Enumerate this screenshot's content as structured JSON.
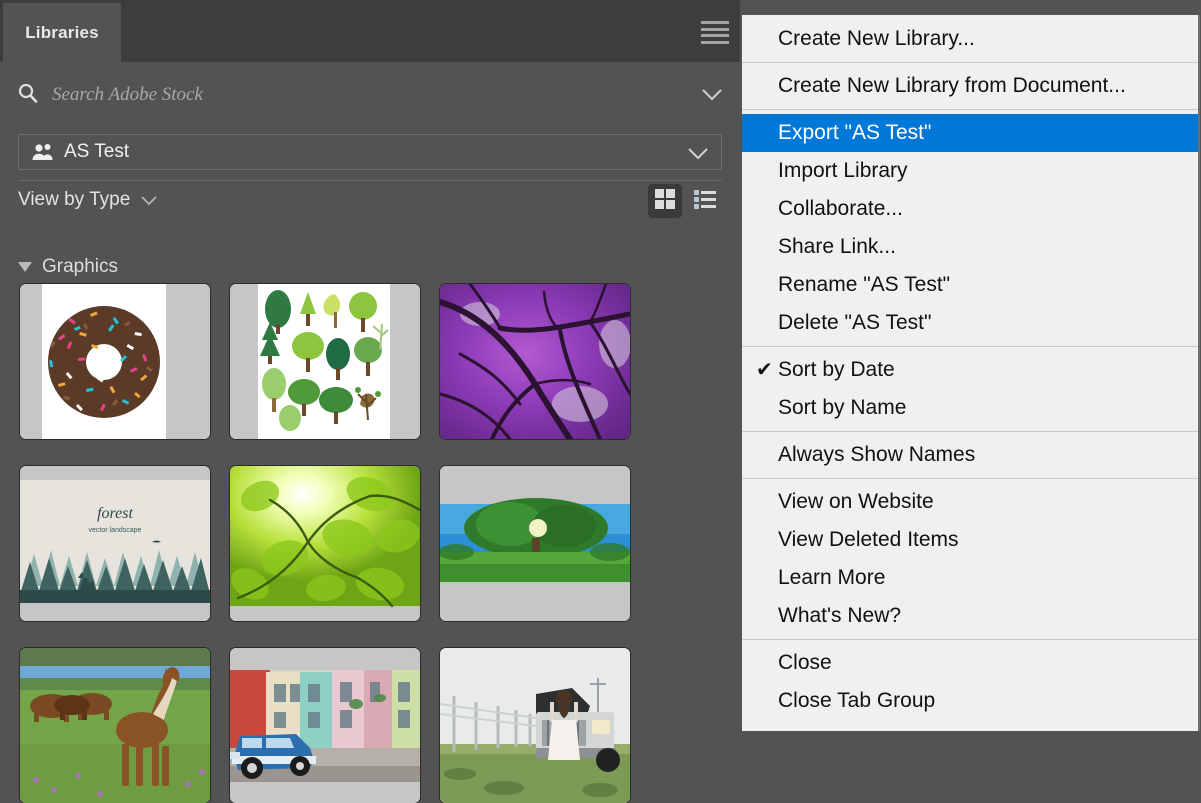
{
  "panel": {
    "tab_label": "Libraries",
    "menu_icon": "hamburger-icon",
    "search": {
      "icon": "search-icon",
      "placeholder": "Search Adobe Stock",
      "value": "",
      "chevron": "chevron-down-icon"
    },
    "library_selector": {
      "icon": "people-icon",
      "name": "AS Test",
      "chevron": "chevron-down-icon"
    },
    "view_by": {
      "label": "View by Type",
      "chevron": "chevron-down-icon"
    },
    "view_toggle": {
      "grid_icon": "grid-view-icon",
      "list_icon": "list-view-icon",
      "active": "grid"
    },
    "section": {
      "label": "Graphics",
      "expanded": true,
      "triangle": "triangle-down-icon"
    },
    "thumbnails": [
      {
        "name": "sprinkle-donut",
        "alt": "Donut covered in rainbow sprinkles"
      },
      {
        "name": "tree-illustration-set",
        "alt": "Set of flat vector trees"
      },
      {
        "name": "purple-jacaranda-canopy",
        "alt": "Purple blossom tree canopy"
      },
      {
        "name": "forest-vector-landscape",
        "alt": "Forest vector landscape with deer"
      },
      {
        "name": "sunlit-green-leaves",
        "alt": "Sun shining through green leaves"
      },
      {
        "name": "lone-tree-meadow",
        "alt": "Large green tree in a sunny meadow"
      },
      {
        "name": "horses-in-pasture",
        "alt": "Brown horses grazing in a field"
      },
      {
        "name": "vintage-blue-car-street",
        "alt": "Classic blue car on colorful street"
      },
      {
        "name": "woman-broken-down-truck",
        "alt": "Woman opening hood of broken down truck"
      }
    ]
  },
  "context_menu": {
    "highlighted": "Export \"AS Test\"",
    "groups": [
      {
        "items": [
          {
            "label": "Create New Library...",
            "checked": false,
            "selected": false
          }
        ]
      },
      {
        "items": [
          {
            "label": "Create New Library from Document...",
            "checked": false,
            "selected": false
          }
        ]
      },
      {
        "items": [
          {
            "label": "Export \"AS Test\"",
            "checked": false,
            "selected": true
          },
          {
            "label": "Import Library",
            "checked": false,
            "selected": false
          },
          {
            "label": "Collaborate...",
            "checked": false,
            "selected": false
          },
          {
            "label": "Share Link...",
            "checked": false,
            "selected": false
          },
          {
            "label": "Rename \"AS Test\"",
            "checked": false,
            "selected": false
          },
          {
            "label": "Delete \"AS Test\"",
            "checked": false,
            "selected": false
          }
        ]
      },
      {
        "items": [
          {
            "label": "Sort by Date",
            "checked": true,
            "selected": false
          },
          {
            "label": "Sort by Name",
            "checked": false,
            "selected": false
          }
        ]
      },
      {
        "items": [
          {
            "label": "Always Show Names",
            "checked": false,
            "selected": false
          }
        ]
      },
      {
        "items": [
          {
            "label": "View on Website",
            "checked": false,
            "selected": false
          },
          {
            "label": "View Deleted Items",
            "checked": false,
            "selected": false
          },
          {
            "label": "Learn More",
            "checked": false,
            "selected": false
          },
          {
            "label": "What's New?",
            "checked": false,
            "selected": false
          }
        ]
      },
      {
        "items": [
          {
            "label": "Close",
            "checked": false,
            "selected": false
          },
          {
            "label": "Close Tab Group",
            "checked": false,
            "selected": false
          }
        ]
      }
    ]
  },
  "colors": {
    "panel_bg": "#535353",
    "tabbar_bg": "#3d3d3d",
    "menu_bg": "#f0f0f0",
    "menu_text": "#111111",
    "highlight_blue": "#0078d7",
    "separator": "#c9c9c9",
    "panel_text": "#e8e8e8"
  }
}
